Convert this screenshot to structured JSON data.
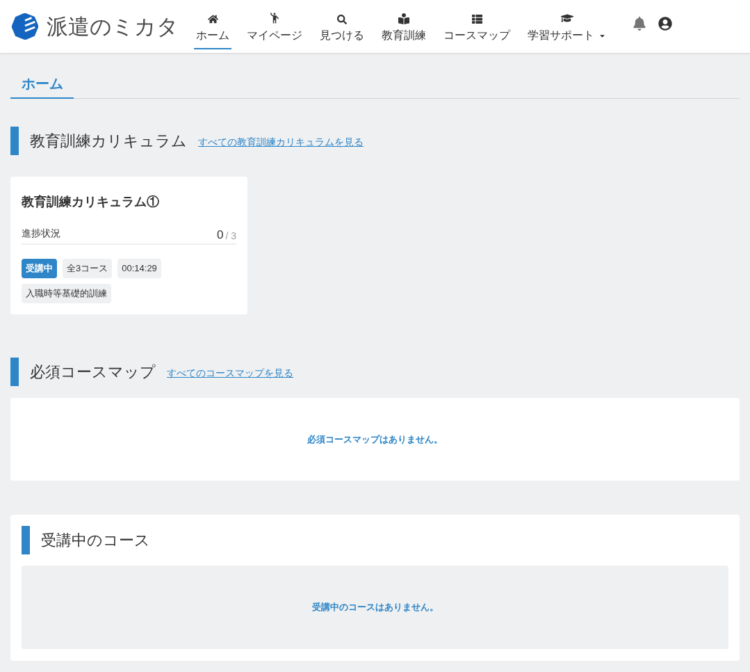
{
  "header": {
    "logo": {
      "text": "派遣のミカタ"
    },
    "nav": [
      {
        "label": "ホーム",
        "selected": true,
        "dropdown": false
      },
      {
        "label": "マイページ",
        "selected": false,
        "dropdown": false
      },
      {
        "label": "見つける",
        "selected": false,
        "dropdown": false
      },
      {
        "label": "教育訓練",
        "selected": false,
        "dropdown": false
      },
      {
        "label": "コースマップ",
        "selected": false,
        "dropdown": false
      },
      {
        "label": "学習サポート",
        "selected": false,
        "dropdown": true
      }
    ]
  },
  "tabs": [
    {
      "label": "ホーム",
      "selected": true
    }
  ],
  "curriculum": {
    "title": "教育訓練カリキュラム",
    "link": "すべての教育訓練カリキュラムを見る",
    "cards": [
      {
        "title": "教育訓練カリキュラム①",
        "progress_label": "進捗状況",
        "progress_done": "0",
        "progress_total": "/ 3",
        "tags": [
          {
            "label": "受講中",
            "kind": "status"
          },
          {
            "label": "全3コース",
            "kind": "plain"
          },
          {
            "label": "00:14:29",
            "kind": "plain"
          },
          {
            "label": "入職時等基礎的訓練",
            "kind": "plain"
          }
        ]
      }
    ]
  },
  "course_maps": {
    "title": "必須コースマップ",
    "link": "すべてのコースマップを見る",
    "empty_message": "必須コースマップはありません。"
  },
  "in_progress": {
    "title": "受講中のコース",
    "empty_message": "受講中のコースはありません。"
  }
}
